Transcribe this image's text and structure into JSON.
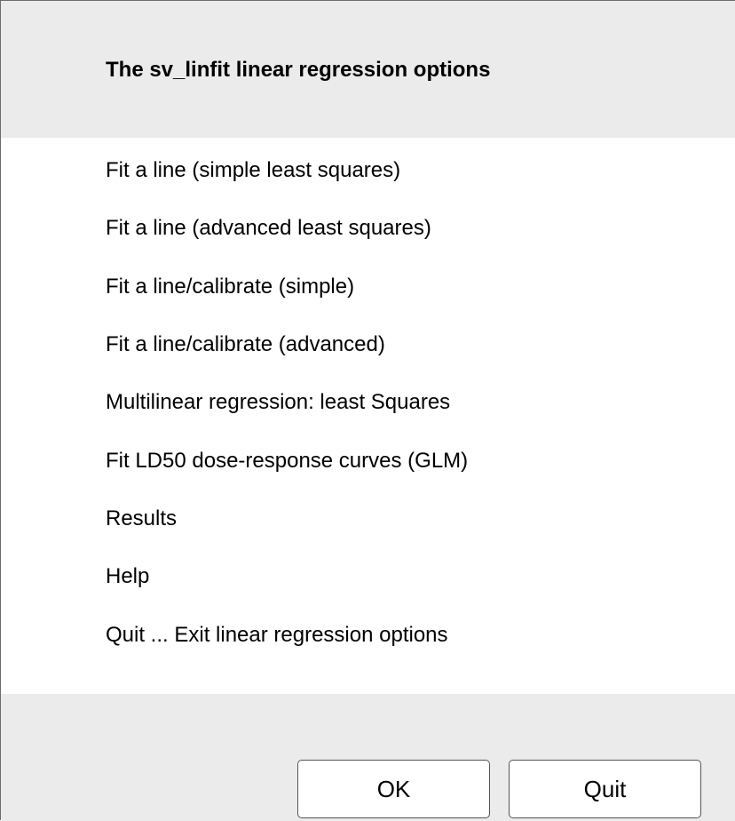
{
  "dialog": {
    "title": "The sv_linfit linear regression options"
  },
  "menu": {
    "items": [
      {
        "label": "Fit a line (simple least squares)"
      },
      {
        "label": "Fit a line (advanced least squares)"
      },
      {
        "label": "Fit a line/calibrate (simple)"
      },
      {
        "label": "Fit a line/calibrate (advanced)"
      },
      {
        "label": "Multilinear regression: least Squares"
      },
      {
        "label": "Fit LD50 dose-response curves (GLM)"
      },
      {
        "label": "Results"
      },
      {
        "label": "Help"
      },
      {
        "label": "Quit ... Exit linear regression options"
      }
    ]
  },
  "buttons": {
    "ok_label": "OK",
    "quit_label": "Quit"
  }
}
